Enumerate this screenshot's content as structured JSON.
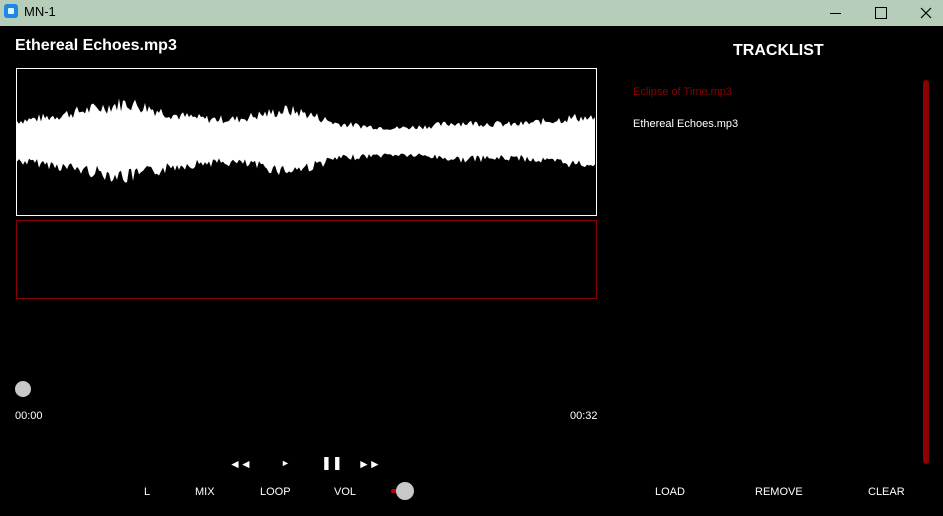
{
  "window": {
    "title": "MN-1",
    "app_icon": "app-icon",
    "titlebar_color": "#b5cdb9"
  },
  "player": {
    "current_track": "Ethereal Echoes.mp3",
    "waveform_color": "#ffffff",
    "position_fraction": 0,
    "time_elapsed": "00:00",
    "time_total": "00:32"
  },
  "transport": {
    "prev_icon": "rewind-icon",
    "prev_glyph": "◄◄",
    "play_icon": "play-icon",
    "play_glyph": "►",
    "pause_icon": "pause-icon",
    "pause_glyph": "❚❚",
    "next_icon": "fast-forward-icon",
    "next_glyph": "►►"
  },
  "options": {
    "l_label": "L",
    "mix_label": "MIX",
    "loop_label": "LOOP",
    "vol_label": "VOL",
    "volume_fraction": 0.05
  },
  "tracklist": {
    "heading": "TRACKLIST",
    "items": [
      {
        "name": "Eclipse of Time.mp3",
        "color": "#8b0000"
      },
      {
        "name": "Ethereal Echoes.mp3",
        "color": "#ffffff"
      }
    ]
  },
  "actions": {
    "load_label": "LOAD",
    "remove_label": "REMOVE",
    "clear_label": "CLEAR"
  },
  "colors": {
    "background": "#000000",
    "accent": "#8b0000",
    "text": "#ffffff"
  }
}
